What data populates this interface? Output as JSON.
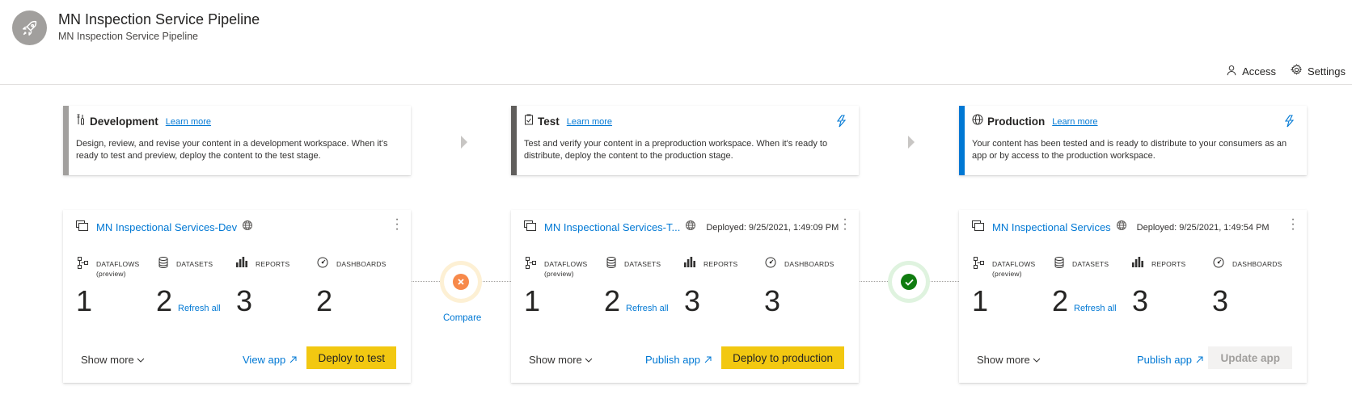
{
  "header": {
    "title": "MN Inspection Service Pipeline",
    "subtitle": "MN Inspection Service Pipeline",
    "access_label": "Access",
    "settings_label": "Settings"
  },
  "stages": [
    {
      "name": "Development",
      "learn_more": "Learn more",
      "description": "Design, review, and revise your content in a development workspace. When it's ready to test and preview, deploy the content to the test stage.",
      "accent_color": "#a19f9d"
    },
    {
      "name": "Test",
      "learn_more": "Learn more",
      "description": "Test and verify your content in a preproduction workspace. When it's ready to distribute, deploy the content to the production stage.",
      "accent_color": "#605e5c"
    },
    {
      "name": "Production",
      "learn_more": "Learn more",
      "description": "Your content has been tested and is ready to distribute to your consumers as an app or by access to the production workspace.",
      "accent_color": "#0078d4"
    }
  ],
  "workspaces": [
    {
      "name": "MN Inspectional Services-Dev",
      "deployed": "",
      "dataflows_label": "DATAFLOWS",
      "dataflows_sub": "(preview)",
      "datasets_label": "DATASETS",
      "reports_label": "REPORTS",
      "dashboards_label": "DASHBOARDS",
      "dataflows": "1",
      "datasets": "2",
      "reports": "3",
      "dashboards": "2",
      "refresh_all": "Refresh all",
      "show_more": "Show more",
      "app_link": "View app",
      "action": "Deploy to test"
    },
    {
      "name": "MN Inspectional Services-T...",
      "deployed": "Deployed: 9/25/2021, 1:49:09 PM",
      "dataflows_label": "DATAFLOWS",
      "dataflows_sub": "(preview)",
      "datasets_label": "DATASETS",
      "reports_label": "REPORTS",
      "dashboards_label": "DASHBOARDS",
      "dataflows": "1",
      "datasets": "2",
      "reports": "3",
      "dashboards": "3",
      "refresh_all": "Refresh all",
      "show_more": "Show more",
      "app_link": "Publish app",
      "action": "Deploy to production"
    },
    {
      "name": "MN Inspectional Services",
      "deployed": "Deployed: 9/25/2021, 1:49:54 PM",
      "dataflows_label": "DATAFLOWS",
      "dataflows_sub": "(preview)",
      "datasets_label": "DATASETS",
      "reports_label": "REPORTS",
      "dashboards_label": "DASHBOARDS",
      "dataflows": "1",
      "datasets": "2",
      "reports": "3",
      "dashboards": "3",
      "refresh_all": "Refresh all",
      "show_more": "Show more",
      "app_link": "Publish app",
      "action": "Update app"
    }
  ],
  "compare": {
    "label": "Compare",
    "dev_test_status": "different",
    "test_prod_status": "same",
    "different_color": "#f7894a",
    "same_color": "#107c10"
  }
}
